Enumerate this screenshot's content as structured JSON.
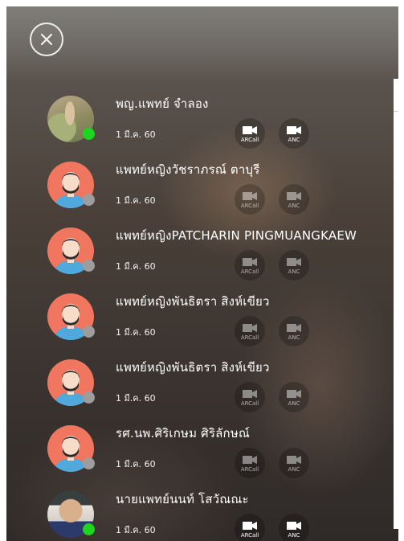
{
  "close_icon": "close-x-icon",
  "colors": {
    "online": "#1ed51e",
    "offline": "#9d9d9d",
    "default_avatar_bg": "#f0765f"
  },
  "contacts": [
    {
      "name": "พญ.แพทย์ จำลอง",
      "date": "1 มี.ค. 60",
      "avatar": "photo",
      "status": "online",
      "arcall_label": "ARCall",
      "anc_label": "ANC",
      "buttons_active": true
    },
    {
      "name": "แพทย์หญิงวัชราภรณ์ ตาบุรี",
      "date": "1 มี.ค. 60",
      "avatar": "default",
      "status": "offline",
      "arcall_label": "ARCall",
      "anc_label": "ANC",
      "buttons_active": false
    },
    {
      "name": "แพทย์หญิงPATCHARIN PINGMUANGKAEW",
      "date": "1 มี.ค. 60",
      "avatar": "default",
      "status": "offline",
      "arcall_label": "ARCall",
      "anc_label": "ANC",
      "buttons_active": false
    },
    {
      "name": "แพทย์หญิงพันธิตรา สิงห์เขียว",
      "date": "1 มี.ค. 60",
      "avatar": "default",
      "status": "offline",
      "arcall_label": "ARCall",
      "anc_label": "ANC",
      "buttons_active": false
    },
    {
      "name": "แพทย์หญิงพันธิตรา สิงห์เขียว",
      "date": "1 มี.ค. 60",
      "avatar": "default",
      "status": "offline",
      "arcall_label": "ARCall",
      "anc_label": "ANC",
      "buttons_active": false
    },
    {
      "name": "รศ.นพ.ศิริเกษม ศิริลักษณ์",
      "date": "1 มี.ค. 60",
      "avatar": "default",
      "status": "offline",
      "arcall_label": "ARCall",
      "anc_label": "ANC",
      "buttons_active": false
    },
    {
      "name": "นายแพทย์นนท์ โสวัณณะ",
      "date": "1 มี.ค. 60",
      "avatar": "photo",
      "status": "online",
      "arcall_label": "ARCall",
      "anc_label": "ANC",
      "buttons_active": true
    }
  ]
}
